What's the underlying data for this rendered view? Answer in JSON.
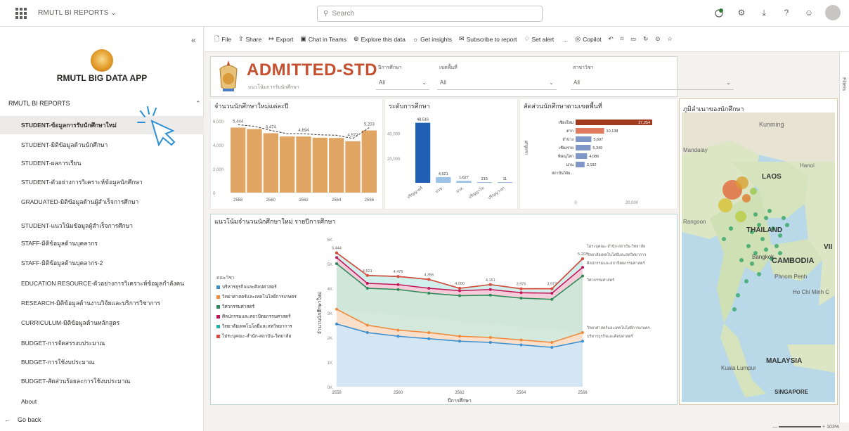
{
  "topbar": {
    "app_name": "RMUTL BI REPORTS",
    "search_placeholder": "Search"
  },
  "sidebar": {
    "app_title": "RMUTL BIG DATA APP",
    "section": "RMUTL BI REPORTS",
    "items": [
      {
        "label": "STUDENT-ข้อมูลการรับนักศึกษาใหม่"
      },
      {
        "label": "STUDENT-มิติข้อมูลด้านนักศึกษา"
      },
      {
        "label": "STUDENT-ผลการเรียน"
      },
      {
        "label": "STUDENT-ตัวอย่างการวิเคราะห์ข้อมูลนักศึกษา"
      },
      {
        "label": "GRADUATED-มิติข้อมูลด้านผู้สำเร็จการศึกษา"
      },
      {
        "label": "STUDENT-แนวโน้มข้อมูลผู้สำเร็จการศึกษา"
      },
      {
        "label": "STAFF-มิติข้อมูลด้านบุคลากร"
      },
      {
        "label": "STAFF-มิติข้อมูลด้านบุคลากร-2"
      },
      {
        "label": "EDUCATION RESOURCE-ตัวอย่างการวิเคราะห์ข้อมูลกำลังคน"
      },
      {
        "label": "RESEARCH-มิติข้อมูลด้านงานวิจัยและบริการวิชาการ"
      },
      {
        "label": "CURRICULUM-มิติข้อมูลด้านหลักสูตร"
      },
      {
        "label": "BUDGET-การจัดสรรงบประมาณ"
      },
      {
        "label": "BUDGET-การใช้งบประมาณ"
      },
      {
        "label": "BUDGET-สัดส่วนร้อยละการใช้งบประมาณ"
      },
      {
        "label": "About"
      }
    ],
    "go_back": "Go back"
  },
  "commandbar": [
    {
      "label": "File",
      "icon": "file-icon"
    },
    {
      "label": "Share",
      "icon": "share-icon"
    },
    {
      "label": "Export",
      "icon": "export-icon"
    },
    {
      "label": "Chat in Teams",
      "icon": "teams-icon"
    },
    {
      "label": "Explore this data",
      "icon": "explore-icon"
    },
    {
      "label": "Get insights",
      "icon": "bulb-icon"
    },
    {
      "label": "Subscribe to report",
      "icon": "subscribe-icon"
    },
    {
      "label": "Set alert",
      "icon": "bell-icon"
    },
    {
      "label": "...",
      "icon": "more-icon"
    },
    {
      "label": "Copilot",
      "icon": "copilot-icon"
    }
  ],
  "report": {
    "title": "ADMITTED-STD",
    "subtitle": "แนวโน้มการรับนักศึกษา",
    "slicers": [
      {
        "label": "ปีการศึกษา",
        "value": "All"
      },
      {
        "label": "เขตพื้นที่",
        "value": "All"
      },
      {
        "label": "สาขาวิชา",
        "value": "All"
      }
    ]
  },
  "chart_data": [
    {
      "type": "bar",
      "title": "จำนวนนักศึกษาใหม่แต่ละปี",
      "categories": [
        "2558",
        "2559",
        "2560",
        "2561",
        "2562",
        "2563",
        "2564",
        "2565",
        "2566"
      ],
      "values": [
        5444,
        5320,
        4974,
        4700,
        4694,
        4600,
        4572,
        4300,
        5203
      ],
      "tick_labels_x": [
        "2558",
        "2560",
        "2562",
        "2564",
        "2566"
      ],
      "tick_labels_y": [
        "0",
        "2,000",
        "4,000",
        "6,000"
      ],
      "data_labels": [
        "5,444",
        "4,474",
        "4,694",
        "4,572",
        "4,5",
        "5,203"
      ],
      "ylim": [
        0,
        6000
      ],
      "color": "#e0a463"
    },
    {
      "type": "bar",
      "title": "ระดับการศึกษา",
      "categories": [
        "ปริญญาตรี",
        "ปวช.",
        "ปวส.",
        "ปริญญาโท",
        "ปริญญาเอก"
      ],
      "values": [
        48516,
        4621,
        1627,
        215,
        11
      ],
      "data_labels": [
        "48,516",
        "4,621",
        "1,627",
        "215",
        "11"
      ],
      "tick_labels_y": [
        "20,000",
        "40,000"
      ],
      "ylim": [
        0,
        50000
      ],
      "color": "#1f5fb4"
    },
    {
      "type": "bar",
      "title": "สัดส่วนนักศึกษาตามเขตพื้นที่",
      "orientation": "horizontal",
      "categories": [
        "เชียงใหม่",
        "ตาก",
        "ลำปาง",
        "เชียงราย",
        "พิษณุโลก",
        "น่าน",
        "สถาบันวิจัย..."
      ],
      "values": [
        27254,
        10138,
        5607,
        5349,
        4086,
        3192,
        0
      ],
      "data_labels": [
        "27,254",
        "10,138",
        "5,607",
        "5,349",
        "4,086",
        "3,192"
      ],
      "axis_label": "เขตพื้นที่",
      "tick_labels_x": [
        "0",
        "20,000"
      ],
      "colors": [
        "#a23b1e",
        "#e07a5f",
        "#7f96c7",
        "#7f96c7",
        "#7f96c7",
        "#7f96c7",
        "#7f96c7"
      ]
    },
    {
      "type": "area",
      "title": "แนวโน้มจำนวนนักศึกษาใหม่ รายปีการศึกษา",
      "xlabel": "ปีการศึกษา",
      "ylabel": "จำนวนนักศึกษาใหม่",
      "x": [
        "2558",
        "2559",
        "2560",
        "2561",
        "2562",
        "2563",
        "2564",
        "2565",
        "2566"
      ],
      "tick_labels_x": [
        "2558",
        "2560",
        "2562",
        "2564",
        "2566"
      ],
      "tick_labels_y": [
        "0K",
        "1K",
        "2K",
        "3K",
        "4K",
        "5K",
        "6K"
      ],
      "top_labels": [
        "5,444",
        "4,521",
        "4,476",
        "4,356",
        "4,000",
        "4,151",
        "3,976",
        "3,977",
        "5,203"
      ],
      "legend_title": "คณะวิชา",
      "series": [
        {
          "name": "บริหารธุรกิจและศิลปศาสตร์",
          "color": "#3a8fd0",
          "values": [
            2.55,
            2.2,
            2.05,
            1.95,
            1.85,
            1.8,
            1.7,
            1.6,
            1.85
          ]
        },
        {
          "name": "วิทยาศาสตร์และเทคโนโลยีการเกษตร",
          "color": "#f08a3a",
          "values": [
            3.15,
            2.5,
            2.3,
            2.2,
            2.05,
            2.0,
            1.9,
            1.8,
            2.2
          ]
        },
        {
          "name": "วิศวกรรมศาสตร์",
          "color": "#2e8b57",
          "values": [
            5.0,
            4.0,
            3.95,
            3.8,
            3.7,
            3.72,
            3.6,
            3.55,
            4.5
          ]
        },
        {
          "name": "ศิลปกรรมและสถาปัตยกรรมศาสตร์",
          "color": "#c2185b",
          "values": [
            5.25,
            4.2,
            4.15,
            4.0,
            3.9,
            3.95,
            3.82,
            3.8,
            4.85
          ]
        },
        {
          "name": "วิทยาลัยเทคโนโลยีและสหวิทยาการ",
          "color": "#1fb5a8",
          "values": [
            5.44,
            4.52,
            4.48,
            4.36,
            4.0,
            4.15,
            3.98,
            3.98,
            5.2
          ]
        },
        {
          "name": "ไม่ระบุคณะ-สำนัก-สถาบัน-วิทยาลัย",
          "color": "#e0483a",
          "values": [
            5.44,
            4.52,
            4.48,
            4.36,
            4.0,
            4.15,
            3.98,
            3.98,
            5.2
          ]
        }
      ],
      "end_labels": [
        "ไม่ระบุคณะ-สำนัก-สถาบัน-วิทยาลัย",
        "วิทยาลัยเทคโนโลยีและสหวิทยาการ",
        "ศิลปกรรมและสถาปัตยกรรมศาสตร์",
        "วิศวกรรมศาสตร์",
        "วิทยาศาสตร์และเทคโนโลยีการเกษตร",
        "บริหารธุรกิจและศิลปศาสตร์"
      ],
      "ylim": [
        0,
        6
      ]
    }
  ],
  "map": {
    "title": "ภูมิลำเนาของนักศึกษา",
    "labels": {
      "laos": "LAOS",
      "thailand": "THAILAND",
      "cambodia": "CAMBODIA",
      "malaysia": "MALAYSIA",
      "kunming": "Kunming",
      "mandalay": "Mandalay",
      "hanoi": "Hanoi",
      "rangoon": "Rangoon",
      "bangkok": "Bangkok",
      "phnom_penh": "Phnom Penh",
      "kuala_lumpur": "Kuala Lumpur",
      "singapore": "SINGAPORE",
      "vi": "VII",
      "hcm": "Ho Chi Minh C"
    }
  },
  "rightpanel": {
    "filters": "Filters"
  },
  "zoom": {
    "value": "103%"
  }
}
